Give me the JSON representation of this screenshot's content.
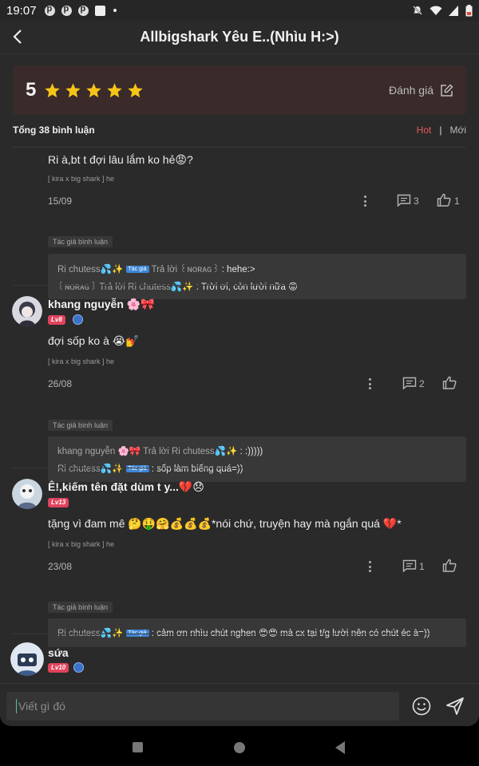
{
  "status_bar": {
    "time": "19:07",
    "battery": "battery-icon"
  },
  "header": {
    "title": "Allbigshark Yêu E..(Nhìu H:>)"
  },
  "rating": {
    "score": "5",
    "stars": 5,
    "rate_label": "Đánh giá"
  },
  "comments_meta": {
    "total": "Tổng 38 bình luận",
    "sort_hot": "Hot",
    "sort_sep": "|",
    "sort_new": "Mới"
  },
  "comments": [
    {
      "text": "Ri à,bt t đợi lâu lắm ko hẻ😡?",
      "tag": "[ kira x big shark ] he",
      "date": "15/09",
      "reply_count": "3",
      "like_count": "1",
      "author_tag": "Tác giả bình luận",
      "replies": [
        {
          "user": "Ri chutess💦✨",
          "badge": "Tác giả",
          "verb": "Trả lời",
          "target": "꒰ɴᴏʀᴀɢ꒱",
          "content": ": hehe:>"
        },
        {
          "user": "꒰ɴᴏʀᴀɢ꒱",
          "verb": "Trả lời",
          "target": "Ri chutess💦✨",
          "content": ": Trời ơi, còn lười nữa 😡"
        }
      ]
    },
    {
      "user": "khang nguyễn 🌸🎀",
      "level": "Lv8",
      "text": "đợi sốp ko à 😭💅",
      "tag": "[ kira x big shark ] he",
      "date": "26/08",
      "reply_count": "2",
      "author_tag": "Tác giả bình luận",
      "replies": [
        {
          "user": "khang nguyễn 🌸🎀",
          "verb": "Trả lời",
          "target": "Ri chutess💦✨",
          "content": ": :)))))"
        },
        {
          "user": "Ri chutess💦✨",
          "badge": "Tác giả",
          "content": ": sốp làm biếng quá=))"
        }
      ]
    },
    {
      "user": "Ê!,kiếm tên đặt dùm t y...💔😞",
      "level": "Lv13",
      "text": "tặng vì đam mê 🤔🤑🤗💰💰💰*nói chứ, truyện hay mà ngắn quá 💔*",
      "tag": "[ kira x big shark ] he",
      "date": "23/08",
      "reply_count": "1",
      "author_tag": "Tác giả bình luận",
      "replies": [
        {
          "user": "Ri chutess💦✨",
          "badge": "Tác giả",
          "content": ": cảm ơn nhìu chút nghen 😍😍 mà cx tại t/g lười nên có chút éc à=))"
        }
      ]
    },
    {
      "user": "sứa",
      "level": "Lv10"
    }
  ],
  "composer": {
    "placeholder": "Viết gì đó"
  }
}
